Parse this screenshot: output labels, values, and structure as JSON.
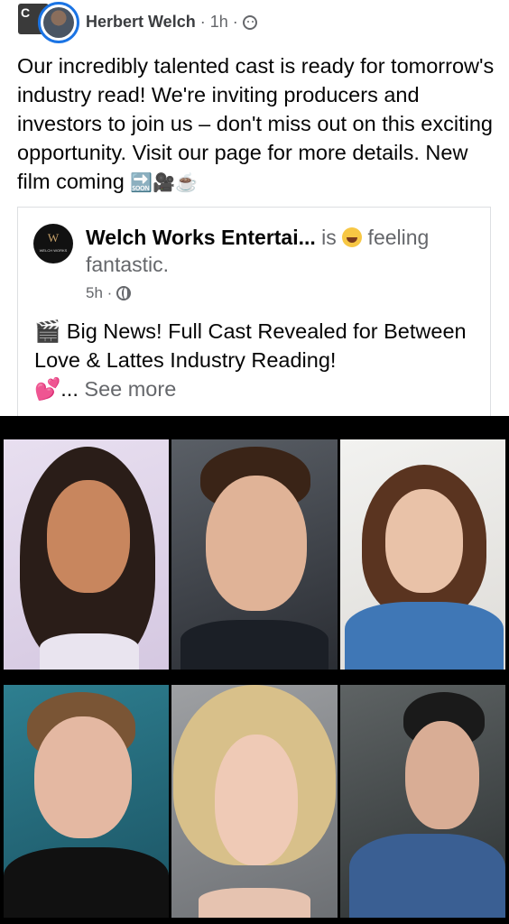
{
  "post": {
    "author": "Herbert Welch",
    "separator1": " · ",
    "time": "1h",
    "separator2": " · ",
    "group_thumb_letter": "C",
    "text": "Our incredibly talented cast is ready for tomorrow's industry read! We're inviting producers and investors to join us – don't miss out on this exciting opportunity. Visit our page for more details. New film coming",
    "text_emojis": "🔜🎥☕"
  },
  "shared": {
    "logo_letter": "W",
    "logo_text": "WELCH WORKS",
    "page_name": "Welch Works Entertai...",
    "is": " is ",
    "feeling": " feeling fantastic.",
    "time": "5h",
    "time_sep": " · ",
    "clapper_emoji": "🎬",
    "text": " Big News! Full Cast Revealed for Between Love & Lattes Industry Reading!",
    "hearts_emoji": "💕",
    "ellipsis": "... ",
    "see_more": "See more"
  }
}
